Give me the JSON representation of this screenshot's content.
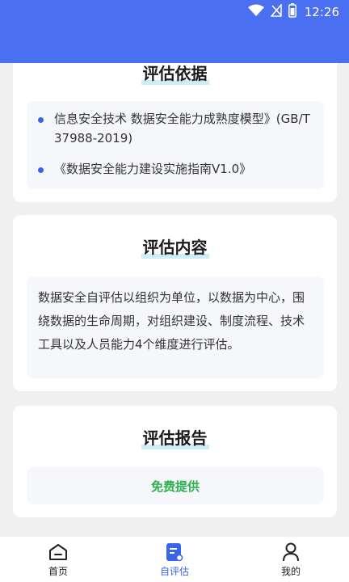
{
  "status_bar": {
    "time": "12:26",
    "icons": [
      "wifi-icon",
      "signal-off-icon",
      "battery-icon"
    ],
    "color": "#4a6ff0"
  },
  "sections": {
    "basis": {
      "title": "评估依据",
      "items": [
        "信息安全技术 数据安全能力成熟度模型》(GB/T 37988-2019)",
        "《数据安全能力建设实施指南V1.0》"
      ]
    },
    "content": {
      "title": "评估内容",
      "text": "数据安全自评估以组织为单位，以数据为中心，围绕数据的生命周期，对组织建设、制度流程、技术工具以及人员能力4个维度进行评估。"
    },
    "report": {
      "title": "评估报告",
      "button_label": "免费提供"
    }
  },
  "tabbar": {
    "tabs": [
      {
        "label": "首页",
        "icon": "home-icon"
      },
      {
        "label": "自评估",
        "icon": "document-icon",
        "active": true
      },
      {
        "label": "我的",
        "icon": "user-icon"
      }
    ],
    "active_color": "#3a64e8"
  },
  "colors": {
    "accent": "#3a64e8",
    "success": "#2db04e"
  }
}
